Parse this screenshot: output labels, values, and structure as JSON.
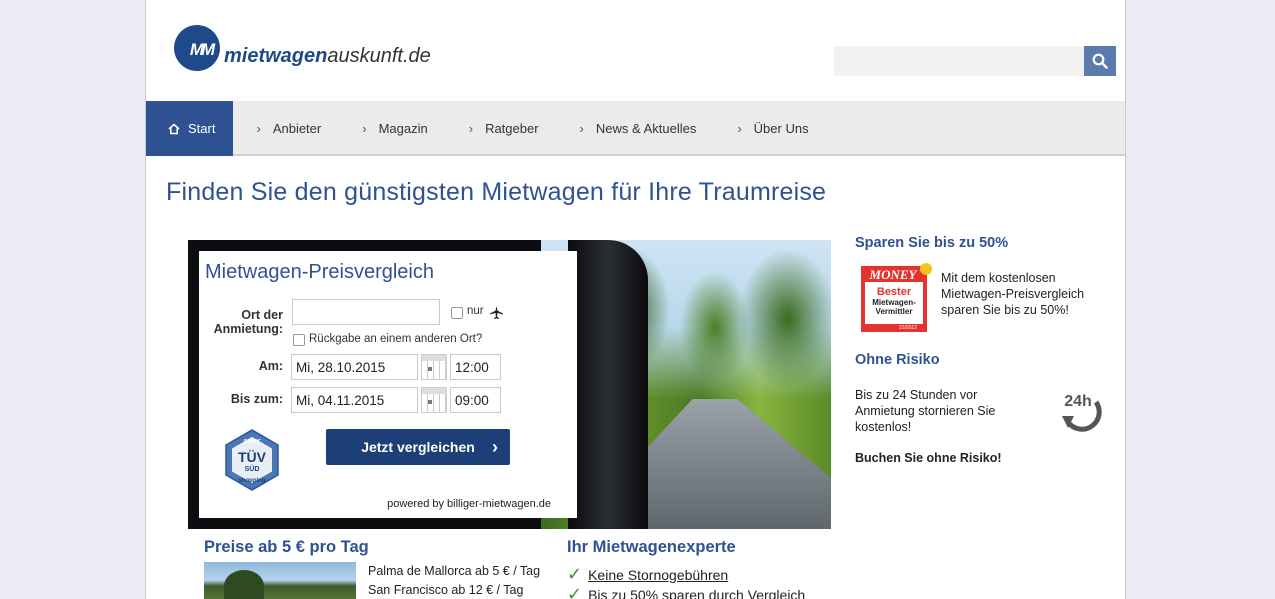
{
  "brand": {
    "logo_mark": "MM",
    "name_bold": "mietwagen",
    "name_rest": "auskunft.de"
  },
  "search": {
    "placeholder": "",
    "icon": "search-icon"
  },
  "nav": {
    "items": [
      {
        "label": "Start",
        "icon": "home-icon",
        "active": true
      },
      {
        "label": "Anbieter"
      },
      {
        "label": "Magazin"
      },
      {
        "label": "Ratgeber"
      },
      {
        "label": "News & Aktuelles"
      },
      {
        "label": "Über Uns"
      }
    ]
  },
  "headline": "Finden Sie den günstigsten Mietwagen für Ihre Traumreise",
  "form": {
    "title": "Mietwagen-Preisvergleich",
    "pickup_label_1": "Ort der",
    "pickup_label_2": "Anmietung:",
    "pickup_value": "",
    "airport_only": "nur",
    "return_other": "Rückgabe an einem anderen Ort?",
    "from_label": "Am:",
    "from_date": "Mi, 28.10.2015",
    "from_time": "12:00",
    "to_label": "Bis zum:",
    "to_date": "Mi, 04.11.2015",
    "to_time": "09:00",
    "submit": "Jetzt vergleichen",
    "powered_by": "powered by billiger-mietwagen.de",
    "badge": {
      "top": "safer",
      "middle": "TÜV",
      "sub": "SÜD",
      "bottom": "shopping"
    }
  },
  "sidebar": {
    "save_title": "Sparen Sie bis zu 50%",
    "save_lines": [
      "Mit dem kostenlosen",
      "Mietwagen-Preisvergleich",
      "sparen Sie bis zu 50%!"
    ],
    "award": {
      "brand": "MONEY",
      "line1": "Bester",
      "line2": "Mietwagen-",
      "line3": "Vermittler",
      "year": "23/2012"
    },
    "risk_title": "Ohne Risiko",
    "risk_lines": [
      "Bis zu 24 Stunden vor",
      "Anmietung stornieren Sie",
      "kostenlos!"
    ],
    "risk_icon_text": "24h",
    "risk_cta": "Buchen Sie ohne Risiko!"
  },
  "prices": {
    "title": "Preise ab 5 € pro Tag",
    "rows": [
      "Palma de Mallorca ab 5 € / Tag",
      "San Francisco ab 12 € / Tag"
    ]
  },
  "expert": {
    "title": "Ihr Mietwagenexperte",
    "rows": [
      "Keine Stornogebühren",
      "Bis zu 50% sparen durch Vergleich"
    ]
  },
  "colors": {
    "primary": "#2e5292",
    "nav_bg": "#ebebeb",
    "cta": "#1c3f77",
    "check": "#3a9a1e"
  }
}
